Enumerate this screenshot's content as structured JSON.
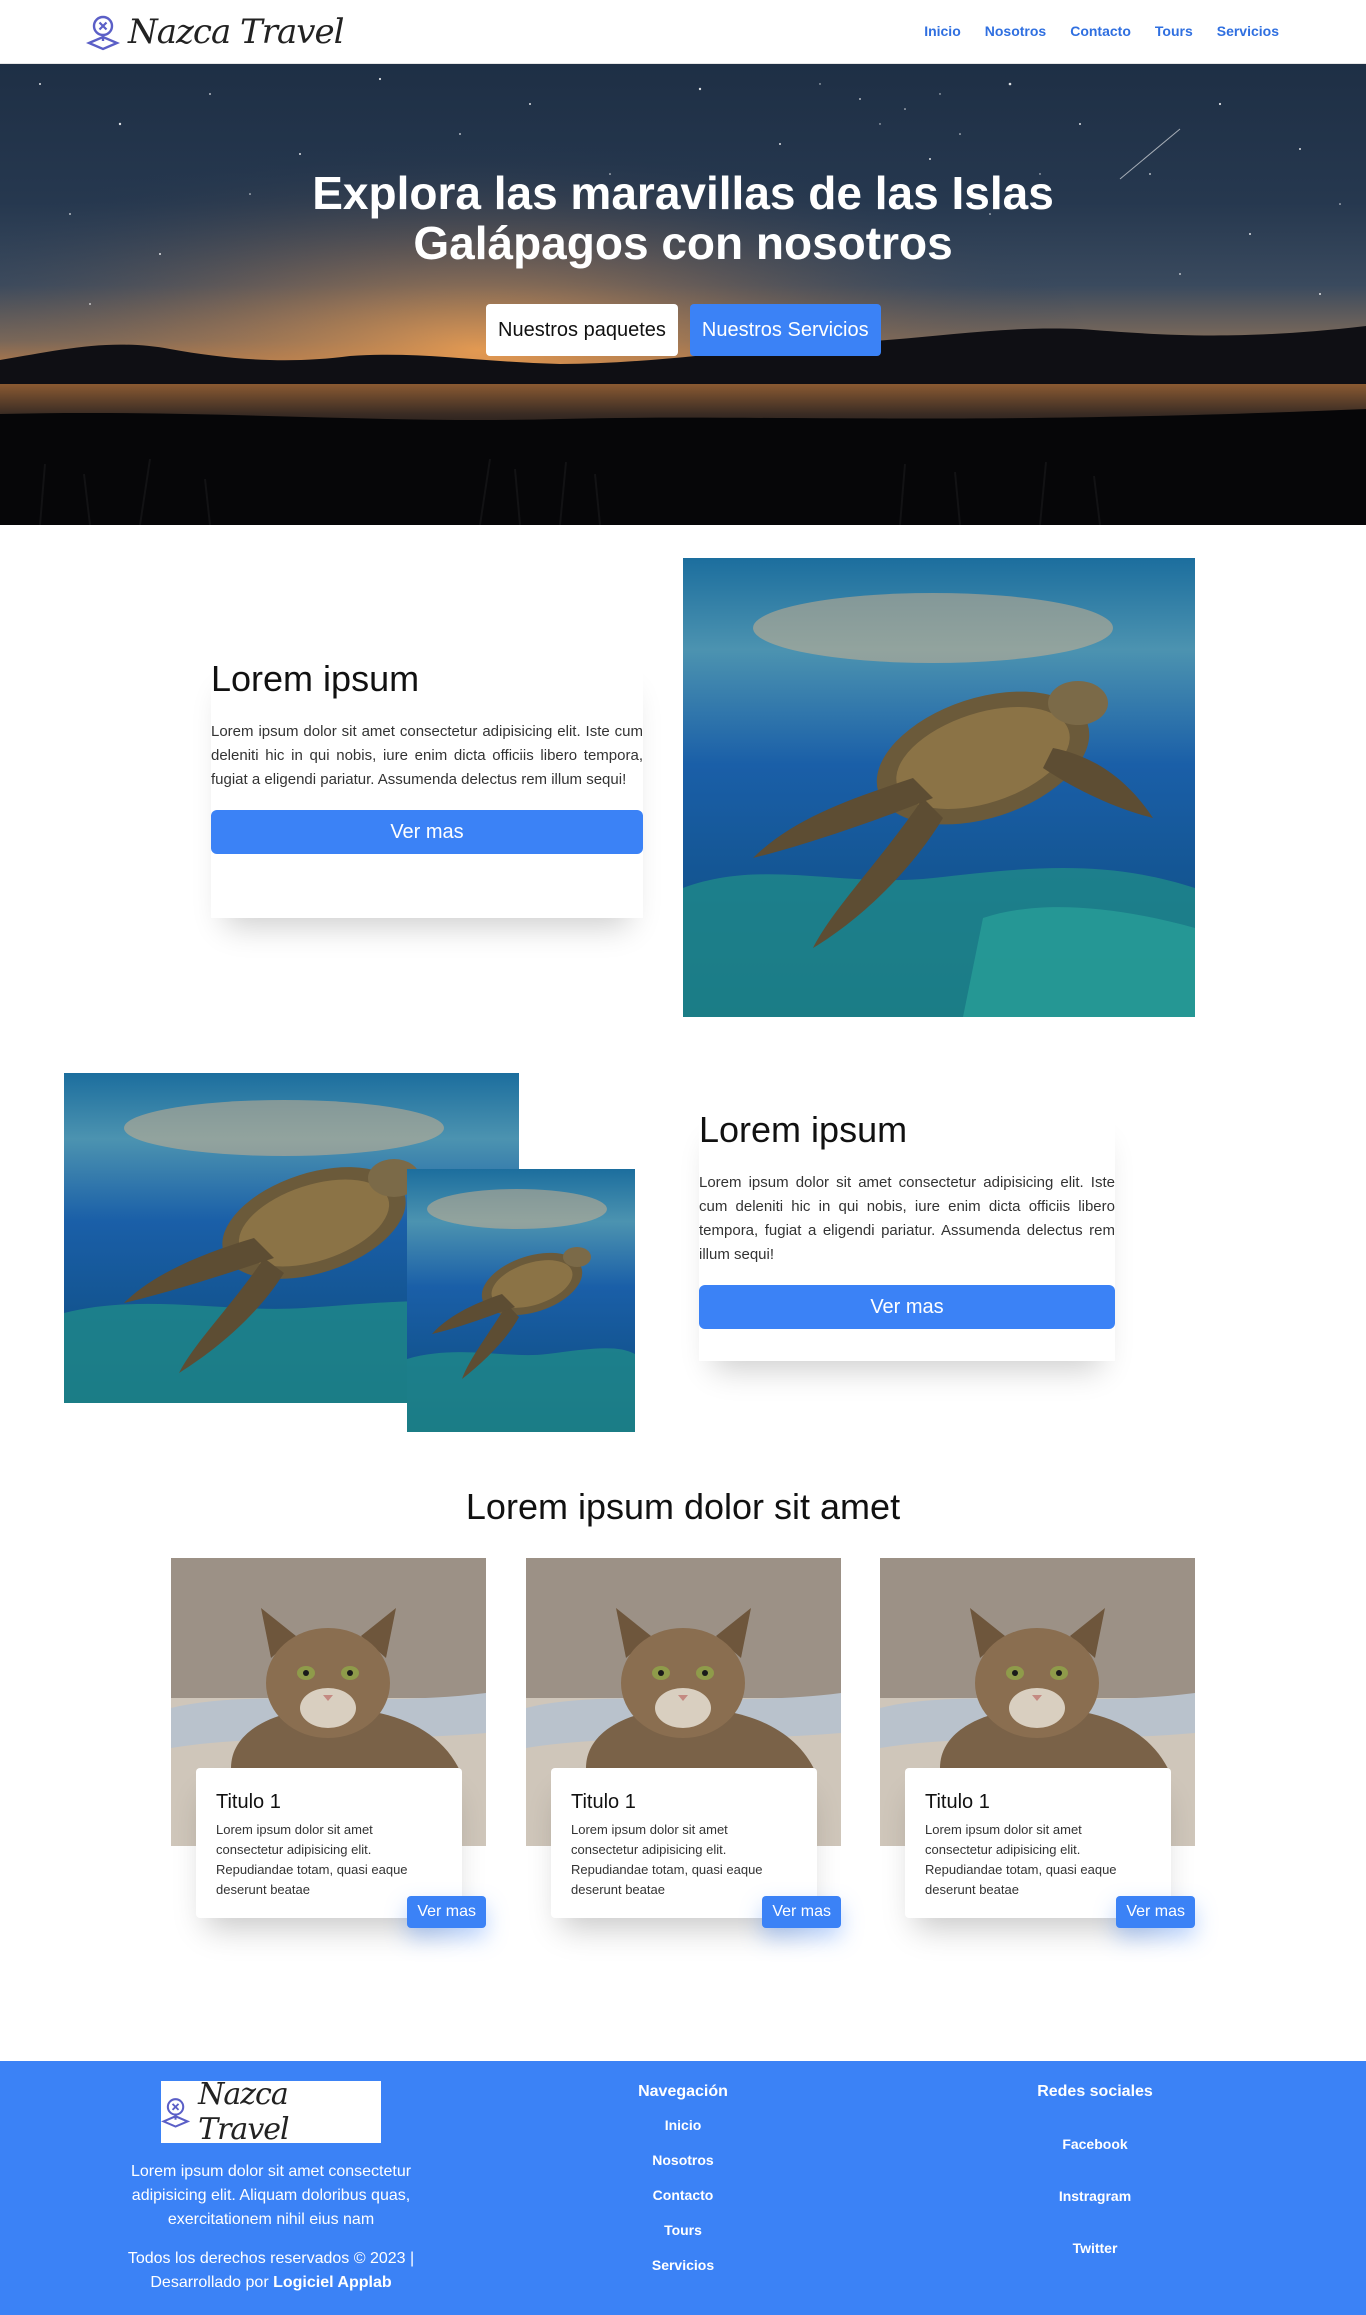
{
  "brand": {
    "name": "Nazca Travel"
  },
  "nav": {
    "items": [
      {
        "label": "Inicio"
      },
      {
        "label": "Nosotros"
      },
      {
        "label": "Contacto"
      },
      {
        "label": "Tours"
      },
      {
        "label": "Servicios"
      }
    ]
  },
  "hero": {
    "title": "Explora las maravillas de las Islas Galápagos con nosotros",
    "primary_button": "Nuestros paquetes",
    "secondary_button": "Nuestros Servicios"
  },
  "feature1": {
    "title": "Lorem ipsum",
    "text": "Lorem ipsum dolor sit amet consectetur adipisicing elit. Iste cum deleniti hic in qui nobis, iure enim dicta officiis libero tempora, fugiat a eligendi pariatur. Assumenda delectus rem illum sequi!",
    "button": "Ver mas"
  },
  "feature2": {
    "title": "Lorem ipsum",
    "text": "Lorem ipsum dolor sit amet consectetur adipisicing elit. Iste cum deleniti hic in qui nobis, iure enim dicta officiis libero tempora, fugiat a eligendi pariatur. Assumenda delectus rem illum sequi!",
    "button": "Ver mas"
  },
  "cards_section": {
    "title": "Lorem ipsum dolor sit amet",
    "cards": [
      {
        "title": "Titulo 1",
        "text": "Lorem ipsum dolor sit amet consectetur adipisicing elit. Repudiandae totam, quasi eaque deserunt beatae",
        "button": "Ver mas"
      },
      {
        "title": "Titulo 1",
        "text": "Lorem ipsum dolor sit amet consectetur adipisicing elit. Repudiandae totam, quasi eaque deserunt beatae",
        "button": "Ver mas"
      },
      {
        "title": "Titulo 1",
        "text": "Lorem ipsum dolor sit amet consectetur adipisicing elit. Repudiandae totam, quasi eaque deserunt beatae",
        "button": "Ver mas"
      }
    ]
  },
  "footer": {
    "description": "Lorem ipsum dolor sit amet consectetur adipisicing elit. Aliquam doloribus quas, exercitationem nihil eius nam",
    "copyright": "Todos los derechos reservados © 2023 | Desarrollado por",
    "developer": "Logiciel Applab",
    "nav_title": "Navegación",
    "nav_items": [
      {
        "label": "Inicio"
      },
      {
        "label": "Nosotros"
      },
      {
        "label": "Contacto"
      },
      {
        "label": "Tours"
      },
      {
        "label": "Servicios"
      }
    ],
    "social_title": "Redes sociales",
    "social_items": [
      {
        "label": "Facebook"
      },
      {
        "label": "Instragram"
      },
      {
        "label": "Twitter"
      }
    ]
  },
  "colors": {
    "accent": "#3b82f6",
    "nav_link": "#2f6fe0",
    "logo_icon": "#5b5fc7"
  }
}
